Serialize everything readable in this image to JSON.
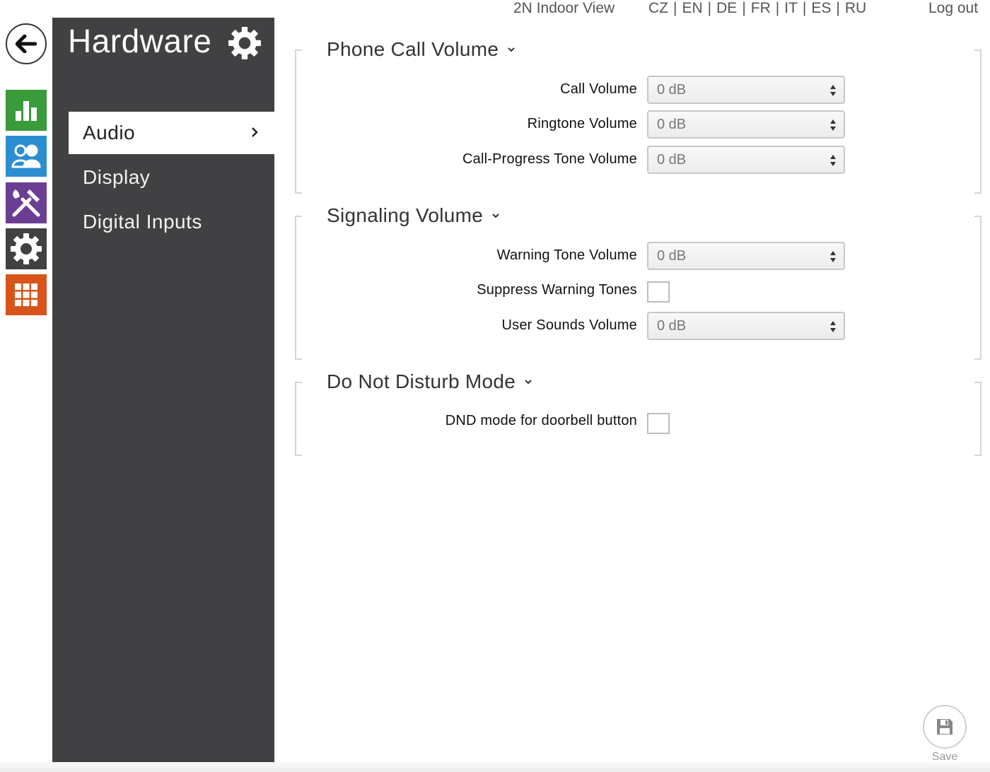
{
  "colors": {
    "panel_bg": "#414143",
    "tile_status": "#3a9b3a",
    "tile_users": "#2b8ed0",
    "tile_services": "#6b3e93",
    "tile_hardware": "#414143",
    "tile_system": "#d9541a"
  },
  "header": {
    "indoor_view": "2N Indoor View",
    "languages": [
      "CZ",
      "EN",
      "DE",
      "FR",
      "IT",
      "ES",
      "RU"
    ],
    "language_separator": "|",
    "logout": "Log out"
  },
  "sidebar": {
    "back_icon": "arrow-left-icon",
    "tiles": [
      {
        "icon": "bar-chart-icon",
        "name": "status"
      },
      {
        "icon": "users-icon",
        "name": "directory"
      },
      {
        "icon": "tools-icon",
        "name": "services"
      },
      {
        "icon": "gear-icon",
        "name": "hardware"
      },
      {
        "icon": "grid-icon",
        "name": "system"
      }
    ]
  },
  "menu": {
    "title": "Hardware",
    "title_icon": "gear-icon",
    "items": [
      {
        "label": "Audio",
        "active": true
      },
      {
        "label": "Display",
        "active": false
      },
      {
        "label": "Digital Inputs",
        "active": false
      }
    ]
  },
  "main": {
    "sections": [
      {
        "title": "Phone Call Volume",
        "fields": [
          {
            "label": "Call Volume",
            "type": "select",
            "value": "0 dB"
          },
          {
            "label": "Ringtone Volume",
            "type": "select",
            "value": "0 dB"
          },
          {
            "label": "Call-Progress Tone Volume",
            "type": "select",
            "value": "0 dB"
          }
        ]
      },
      {
        "title": "Signaling Volume",
        "fields": [
          {
            "label": "Warning Tone Volume",
            "type": "select",
            "value": "0 dB"
          },
          {
            "label": "Suppress Warning Tones",
            "type": "checkbox",
            "checked": false
          },
          {
            "label": "User Sounds Volume",
            "type": "select",
            "value": "0 dB"
          }
        ]
      },
      {
        "title": "Do Not Disturb Mode",
        "fields": [
          {
            "label": "DND mode for doorbell button",
            "type": "checkbox",
            "checked": false
          }
        ]
      }
    ]
  },
  "footer": {
    "save_label": "Save",
    "save_icon": "floppy-disk-icon"
  }
}
